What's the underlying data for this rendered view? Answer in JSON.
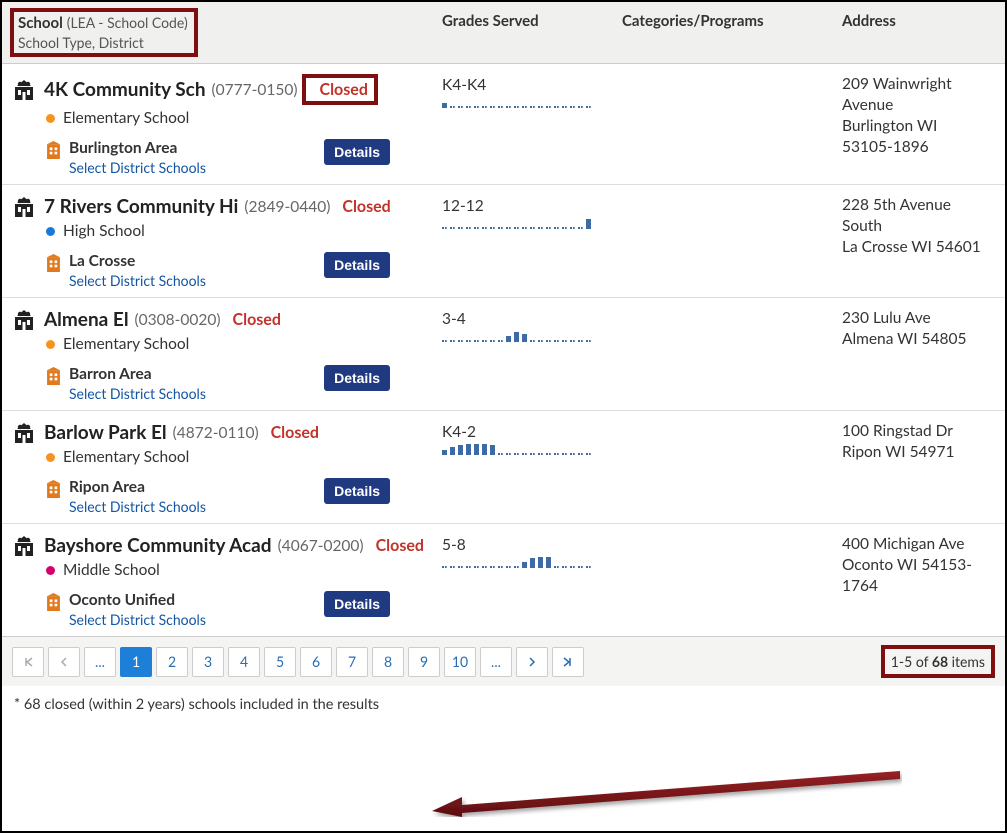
{
  "header": {
    "school_label": "School",
    "school_sub": "(LEA - School Code)",
    "school_line2": "School Type, District",
    "grades": "Grades Served",
    "categories": "Categories/Programs",
    "address": "Address"
  },
  "ui": {
    "details": "Details",
    "select_district": "Select District Schools",
    "closed": "Closed"
  },
  "rows": [
    {
      "name": "4K Community Sch",
      "code": "(0777-0150)",
      "type": "Elementary School",
      "type_color": "orange",
      "district": "Burlington Area",
      "grades": "K4-K4",
      "addr1": "209 Wainwright Avenue",
      "addr2": "Burlington WI 53105-1896",
      "spark": [
        3,
        1,
        1,
        1,
        1,
        1,
        1,
        1,
        1,
        1,
        1,
        1,
        1,
        1,
        1,
        1,
        1,
        1,
        1
      ],
      "highlight_closed": true
    },
    {
      "name": "7 Rivers Community Hi",
      "code": "(2849-0440)",
      "type": "High School",
      "type_color": "blue",
      "district": "La Crosse",
      "grades": "12-12",
      "addr1": "228 5th Avenue South",
      "addr2": "La Crosse WI 54601",
      "spark": [
        1,
        1,
        1,
        1,
        1,
        1,
        1,
        1,
        1,
        1,
        1,
        1,
        1,
        1,
        1,
        1,
        1,
        1,
        6
      ],
      "highlight_closed": false
    },
    {
      "name": "Almena El",
      "code": "(0308-0020)",
      "type": "Elementary School",
      "type_color": "orange",
      "district": "Barron Area",
      "grades": "3-4",
      "addr1": "230 Lulu Ave",
      "addr2": "Almena WI 54805",
      "spark": [
        1,
        1,
        1,
        1,
        1,
        1,
        1,
        1,
        4,
        6,
        5,
        1,
        1,
        1,
        1,
        1,
        1,
        1,
        1
      ],
      "highlight_closed": false
    },
    {
      "name": "Barlow Park El",
      "code": "(4872-0110)",
      "type": "Elementary School",
      "type_color": "orange",
      "district": "Ripon Area",
      "grades": "K4-2",
      "addr1": "100 Ringstad Dr",
      "addr2": "Ripon WI 54971",
      "spark": [
        3,
        5,
        6,
        7,
        7,
        7,
        6,
        1,
        1,
        1,
        1,
        1,
        1,
        1,
        1,
        1,
        1,
        1,
        1
      ],
      "highlight_closed": false
    },
    {
      "name": "Bayshore Community Acad",
      "code": "(4067-0200)",
      "type": "Middle School",
      "type_color": "magenta",
      "district": "Oconto Unified",
      "grades": "5-8",
      "addr1": "400 Michigan Ave",
      "addr2": "Oconto WI 54153-1764",
      "spark": [
        1,
        1,
        1,
        1,
        1,
        1,
        1,
        1,
        1,
        1,
        4,
        6,
        7,
        7,
        1,
        1,
        1,
        1,
        1
      ],
      "highlight_closed": false
    }
  ],
  "pager": {
    "pages": [
      "1",
      "2",
      "3",
      "4",
      "5",
      "6",
      "7",
      "8",
      "9",
      "10"
    ],
    "active": "1",
    "info_pre": "1-5 of ",
    "info_total": "68",
    "info_post": " items"
  },
  "footnote": "* 68 closed (within 2 years) schools included in the results"
}
